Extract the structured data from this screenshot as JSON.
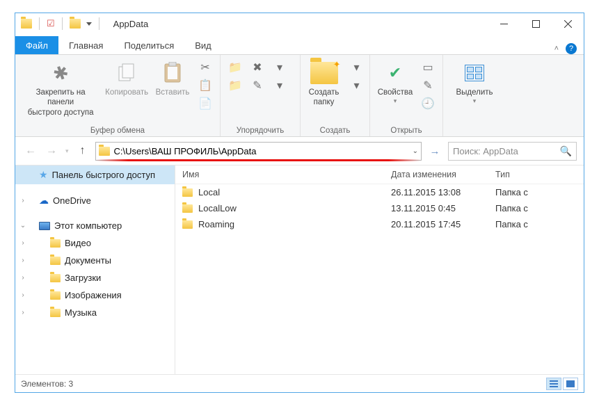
{
  "title": "AppData",
  "tabs": {
    "file": "Файл",
    "home": "Главная",
    "share": "Поделиться",
    "view": "Вид"
  },
  "ribbon": {
    "pin": "Закрепить на панели\nбыстрого доступа",
    "copy": "Копировать",
    "paste": "Вставить",
    "group_clipboard": "Буфер обмена",
    "group_organize": "Упорядочить",
    "new_folder": "Создать\nпапку",
    "group_new": "Создать",
    "properties": "Свойства",
    "group_open": "Открыть",
    "select": "Выделить",
    "group_select": ""
  },
  "address": "C:\\Users\\ВАШ ПРОФИЛЬ\\AppData",
  "search_placeholder": "Поиск: AppData",
  "columns": {
    "name": "Имя",
    "date": "Дата изменения",
    "type": "Тип"
  },
  "sidebar": {
    "quick": "Панель быстрого доступ",
    "onedrive": "OneDrive",
    "thispc": "Этот компьютер",
    "videos": "Видео",
    "documents": "Документы",
    "downloads": "Загрузки",
    "pictures": "Изображения",
    "music": "Музыка"
  },
  "rows": [
    {
      "name": "Local",
      "date": "26.11.2015 13:08",
      "type": "Папка с"
    },
    {
      "name": "LocalLow",
      "date": "13.11.2015 0:45",
      "type": "Папка с"
    },
    {
      "name": "Roaming",
      "date": "20.11.2015 17:45",
      "type": "Папка с"
    }
  ],
  "status": "Элементов: 3"
}
